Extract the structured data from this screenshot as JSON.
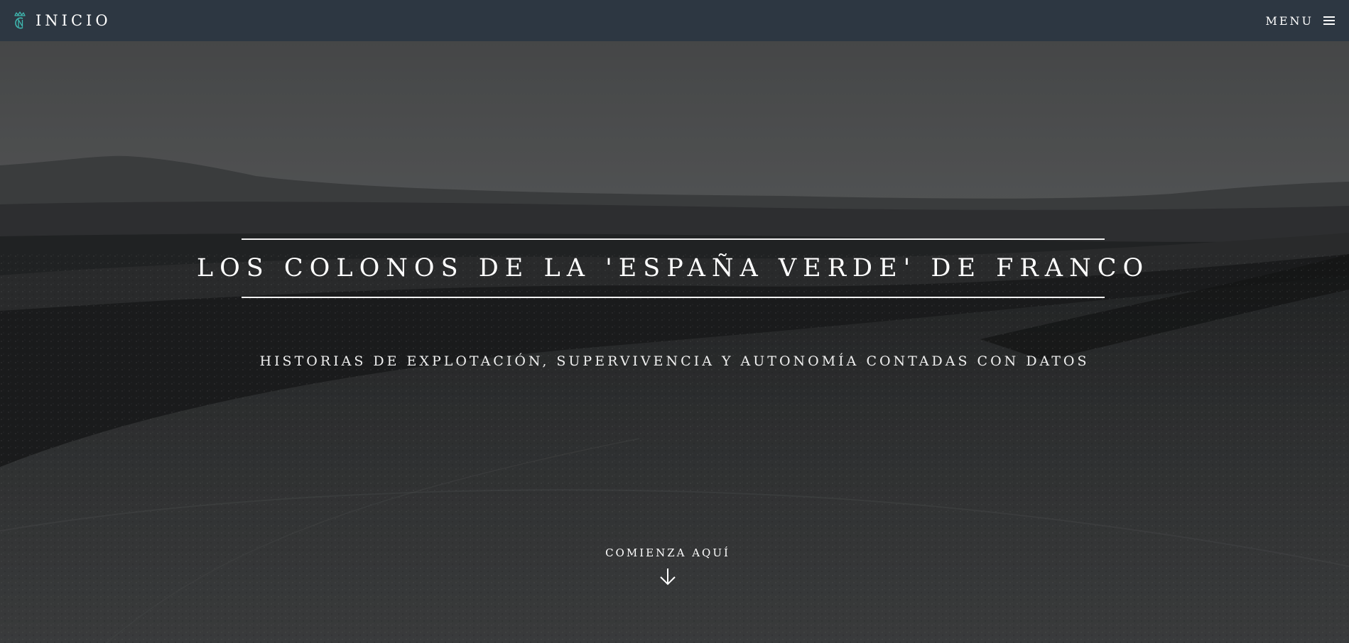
{
  "navbar": {
    "brand_label": "INICIO",
    "brand_icon": "crown-monogram-logo",
    "menu_label": "MENU",
    "menu_icon": "hamburger-icon"
  },
  "hero": {
    "title": "LOS COLONOS DE LA 'ESPAÑA VERDE' DE FRANCO",
    "subtitle": "HISTORIAS DE EXPLOTACIÓN, SUPERVIVENCIA Y AUTONOMÍA CONTADAS CON DATOS",
    "cta_label": "COMIENZA AQUÍ",
    "cta_icon": "arrow-down-icon",
    "background": "black-and-white landscape photograph of ploughed fields and hills"
  },
  "colors": {
    "navbar_bg": "#2d3742",
    "logo_accent": "#3fb8b0",
    "text": "#ffffff"
  }
}
